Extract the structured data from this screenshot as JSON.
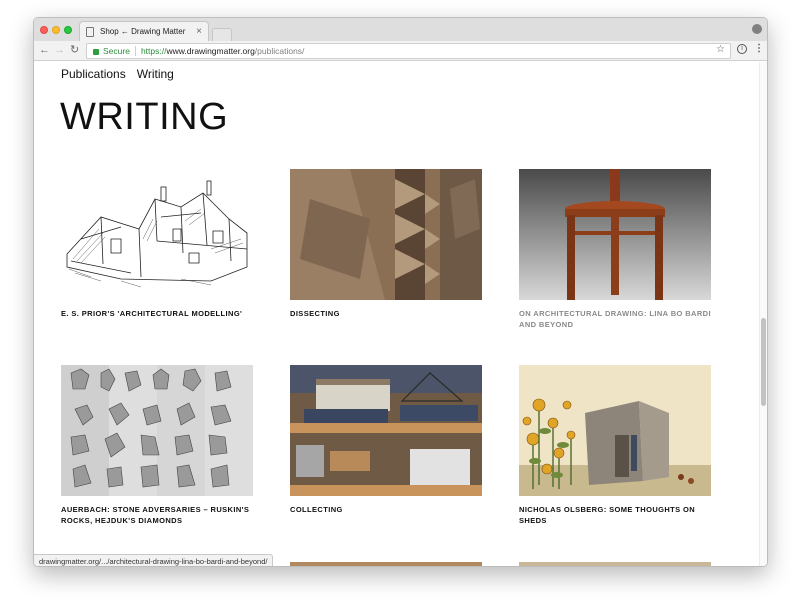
{
  "browser": {
    "tab_title": "Shop ← Drawing Matter",
    "tab_close": "×",
    "secure_label": "Secure",
    "url_scheme": "https://",
    "url_host": "www.drawingmatter.org",
    "url_path": "/publications/",
    "status_url": "drawingmatter.org/.../architectural-drawing-lina-bo-bardi-and-beyond/"
  },
  "nav": {
    "publications": "Publications",
    "writing": "Writing"
  },
  "page_title": "WRITING",
  "cards": [
    {
      "title": "E. S. PRIOR'S 'ARCHITECTURAL MODELLING'",
      "image": "sketch-house"
    },
    {
      "title": "DISSECTING",
      "image": "carved-stone"
    },
    {
      "title": "ON ARCHITECTURAL DRAWING: LINA BO BARDI AND BEYOND",
      "image": "wooden-stool",
      "visited": true
    },
    {
      "title": "AUERBACH: STONE ADVERSARIES – RUSKIN'S ROCKS, HEJDUK'S DIAMONDS",
      "image": "crystal-plates"
    },
    {
      "title": "COLLECTING",
      "image": "model-shelves"
    },
    {
      "title": "NICHOLAS OLSBERG: SOME THOUGHTS ON SHEDS",
      "image": "sunflower-painting"
    }
  ],
  "icons": {
    "back": "←",
    "forward": "→",
    "reload": "↻",
    "star": "☆",
    "info": "i",
    "menu": "⋮"
  }
}
